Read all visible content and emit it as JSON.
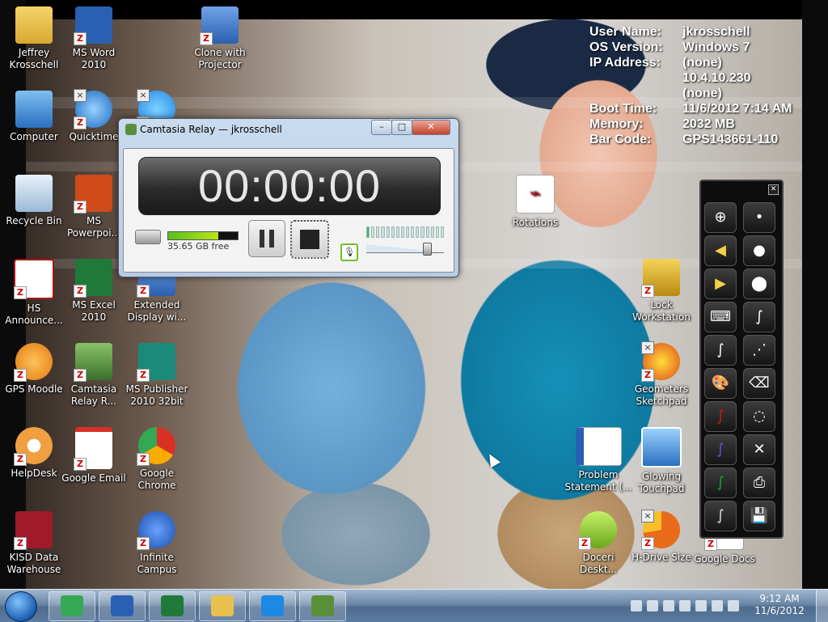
{
  "desktop": {
    "icons": [
      {
        "id": "jeffrey",
        "label": "Jeffrey Krosschell",
        "icon": "user-folder-icon",
        "color": "#e8c050"
      },
      {
        "id": "msword",
        "label": "MS Word 2010",
        "icon": "word-icon",
        "color": "#2b5fb4"
      },
      {
        "id": "clone",
        "label": "Clone with Projector",
        "icon": "display-clone-icon",
        "color": "#3a6ec0"
      },
      {
        "id": "computer",
        "label": "Computer",
        "icon": "computer-icon",
        "color": "#4a90d9"
      },
      {
        "id": "quicktime",
        "label": "Quicktime",
        "icon": "quicktime-icon",
        "color": "#2a7fd0"
      },
      {
        "id": "ie-shortcut",
        "label": "",
        "icon": "internet-explorer-icon",
        "color": "#1e88e5"
      },
      {
        "id": "recycle",
        "label": "Recycle Bin",
        "icon": "recycle-bin-icon",
        "color": "#a9c4dc"
      },
      {
        "id": "powerpoint",
        "label": "MS Powerpoi...",
        "icon": "powerpoint-icon",
        "color": "#d04a1a"
      },
      {
        "id": "hs",
        "label": "HS Announce...",
        "icon": "hs-announce-icon",
        "color": "#b01010"
      },
      {
        "id": "excel",
        "label": "MS Excel 2010",
        "icon": "excel-icon",
        "color": "#1f7a3a"
      },
      {
        "id": "extdisplay",
        "label": "Extended Display wi...",
        "icon": "display-extend-icon",
        "color": "#3a6ec0"
      },
      {
        "id": "moodle",
        "label": "GPS Moodle",
        "icon": "moodle-icon",
        "color": "#f08a1a"
      },
      {
        "id": "camtasia",
        "label": "Camtasia Relay R...",
        "icon": "camtasia-relay-icon",
        "color": "#5a8f3a"
      },
      {
        "id": "publisher",
        "label": "MS Publisher 2010 32bit",
        "icon": "publisher-icon",
        "color": "#1a8a7a"
      },
      {
        "id": "helpdesk",
        "label": "HelpDesk",
        "icon": "helpdesk-icon",
        "color": "#f0a040"
      },
      {
        "id": "gmail",
        "label": "Google Email",
        "icon": "gmail-icon",
        "color": "#d93025"
      },
      {
        "id": "chrome",
        "label": "Google Chrome",
        "icon": "chrome-icon",
        "color": "#34a853"
      },
      {
        "id": "kisd",
        "label": "KISD Data Warehouse",
        "icon": "kisd-icon",
        "color": "#a01a2a"
      },
      {
        "id": "infinite",
        "label": "Infinite Campus",
        "icon": "infinite-campus-icon",
        "color": "#1a4fa8"
      },
      {
        "id": "rotations",
        "label": "Rotations",
        "icon": "pdf-icon",
        "color": "#cc1111"
      },
      {
        "id": "lock",
        "label": "Lock Workstation",
        "icon": "lock-icon",
        "color": "#d4a017"
      },
      {
        "id": "geometers",
        "label": "Geometers Sketchpad",
        "icon": "sketchpad-icon",
        "color": "#e04a1a"
      },
      {
        "id": "problem",
        "label": "Problem Statement (...",
        "icon": "word-document-icon",
        "color": "#2b5fb4"
      },
      {
        "id": "glowing",
        "label": "Glowing Touchpad",
        "icon": "touchpad-image-icon",
        "color": "#3a8fd0"
      },
      {
        "id": "doceri",
        "label": "Doceri Deskt...",
        "icon": "doceri-icon",
        "color": "#8fcf2a"
      },
      {
        "id": "hdrive",
        "label": "H-Drive Size",
        "icon": "pie-chart-icon",
        "color": "#e86a1a"
      },
      {
        "id": "gdocs",
        "label": "Google Docs",
        "icon": "google-docs-icon",
        "color": "#4285f4"
      }
    ]
  },
  "sysinfo": {
    "rows": [
      {
        "k": "User Name:",
        "v": "jkrosschell"
      },
      {
        "k": "OS Version:",
        "v": "Windows 7"
      },
      {
        "k": "IP Address:",
        "v": "(none)"
      },
      {
        "k": "",
        "v": "10.4.10.230"
      },
      {
        "k": "",
        "v": "(none)"
      },
      {
        "k": "Boot Time:",
        "v": "11/6/2012 7:14 AM"
      },
      {
        "k": "Memory:",
        "v": "2032 MB"
      },
      {
        "k": "Bar Code:",
        "v": "GPS143661-110"
      }
    ]
  },
  "camtasia": {
    "title": "Camtasia Relay — jkrosschell",
    "timer": "00:00:00",
    "disk_free": "35.65 GB free",
    "disk_used_fraction": 0.72,
    "level_segments_on": 1,
    "level_segments_total": 16,
    "volume_fraction": 0.78,
    "buttons": {
      "pause": "pause-icon",
      "stop": "stop-icon",
      "mic": "microphone-icon"
    }
  },
  "doceri_toolbar": {
    "tools_left": [
      "zoom-pan-icon",
      "undo-arrow-icon",
      "redo-arrow-icon",
      "keyboard-icon",
      "pen-select-icon",
      "palette-icon",
      "red-pen-icon",
      "purple-pen-icon",
      "green-pen-icon",
      "black-pen-icon"
    ],
    "tools_right": [
      "small-dot-icon",
      "medium-dot-icon",
      "large-dot-icon",
      "thin-stroke-icon",
      "dashed-stroke-icon",
      "eraser-icon",
      "lasso-eraser-icon",
      "clear-eraser-icon",
      "printer-icon",
      "save-icon"
    ],
    "colors": {
      "red": "#d11",
      "purple": "#6a4fd8",
      "green": "#1aa33a",
      "black": "#111"
    }
  },
  "taskbar": {
    "apps": [
      {
        "id": "chrome",
        "icon": "chrome-icon",
        "color": "#34a853"
      },
      {
        "id": "word",
        "icon": "word-icon",
        "color": "#2b5fb4"
      },
      {
        "id": "excel",
        "icon": "excel-icon",
        "color": "#1f7a3a"
      },
      {
        "id": "explorer",
        "icon": "folder-icon",
        "color": "#e8c050"
      },
      {
        "id": "ie",
        "icon": "internet-explorer-icon",
        "color": "#1e88e5"
      },
      {
        "id": "camtasia",
        "icon": "camtasia-relay-icon",
        "color": "#5a8f3a"
      }
    ],
    "clock_time": "9:12 AM",
    "clock_date": "11/6/2012",
    "tray_icons": [
      "security-icon",
      "action-center-icon",
      "network-icon",
      "bluetooth-icon",
      "monitor-icon",
      "projector-icon",
      "volume-icon"
    ]
  }
}
